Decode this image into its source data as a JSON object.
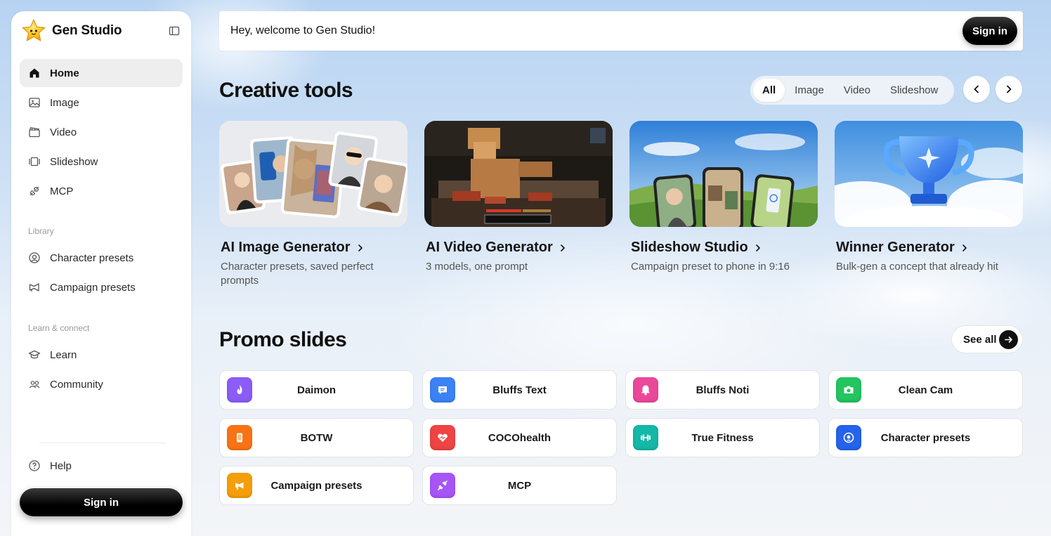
{
  "app": {
    "name": "Gen Studio"
  },
  "sidebar": {
    "main_items": [
      {
        "label": "Home",
        "icon": "home-icon",
        "active": true
      },
      {
        "label": "Image",
        "icon": "image-icon"
      },
      {
        "label": "Video",
        "icon": "video-icon"
      },
      {
        "label": "Slideshow",
        "icon": "slideshow-icon"
      },
      {
        "label": "MCP",
        "icon": "plug-icon"
      }
    ],
    "library_label": "Library",
    "library_items": [
      {
        "label": "Character presets",
        "icon": "character-icon"
      },
      {
        "label": "Campaign presets",
        "icon": "megaphone-icon"
      }
    ],
    "learn_label": "Learn & connect",
    "learn_items": [
      {
        "label": "Learn",
        "icon": "graduation-cap-icon"
      },
      {
        "label": "Community",
        "icon": "users-icon"
      }
    ],
    "help_label": "Help",
    "signin_label": "Sign in"
  },
  "header": {
    "welcome": "Hey, welcome to Gen Studio!",
    "signin_label": "Sign in"
  },
  "creative_tools": {
    "title": "Creative tools",
    "filters": [
      "All",
      "Image",
      "Video",
      "Slideshow"
    ],
    "active_filter": "All",
    "cards": [
      {
        "title": "AI Image Generator",
        "desc": "Character presets, saved perfect prompts"
      },
      {
        "title": "AI Video Generator",
        "desc": "3 models, one prompt"
      },
      {
        "title": "Slideshow Studio",
        "desc": "Campaign preset to phone in 9:16"
      },
      {
        "title": "Winner Generator",
        "desc": "Bulk-gen a concept that already hit"
      }
    ]
  },
  "promo": {
    "title": "Promo slides",
    "see_all": "See all",
    "items": [
      {
        "label": "Daimon",
        "icon": "flame-icon",
        "color": "#8b5cf6"
      },
      {
        "label": "Bluffs Text",
        "icon": "chat-icon",
        "color": "#3b82f6"
      },
      {
        "label": "Bluffs Noti",
        "icon": "bell-icon",
        "color": "#ec4899"
      },
      {
        "label": "Clean Cam",
        "icon": "camera-icon",
        "color": "#22c55e"
      },
      {
        "label": "BOTW",
        "icon": "phone-icon",
        "color": "#f97316"
      },
      {
        "label": "COCOhealth",
        "icon": "heart-icon",
        "color": "#ef4444"
      },
      {
        "label": "True Fitness",
        "icon": "dumbbell-icon",
        "color": "#14b8a6"
      },
      {
        "label": "Character presets",
        "icon": "user-circle-icon",
        "color": "#2563eb"
      },
      {
        "label": "Campaign presets",
        "icon": "megaphone-icon",
        "color": "#f59e0b"
      },
      {
        "label": "MCP",
        "icon": "plug-icon",
        "color": "#a855f7"
      }
    ]
  }
}
